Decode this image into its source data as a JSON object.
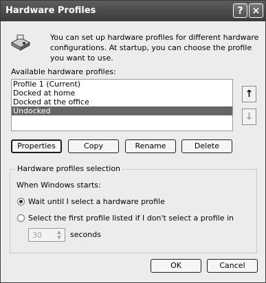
{
  "window": {
    "title": "Hardware Profiles",
    "help_icon": "?",
    "close_icon": "×"
  },
  "intro": {
    "icon": "hardware-profiles-icon",
    "text": "You can set up hardware profiles for different hardware configurations.  At startup, you can choose the profile you want to use."
  },
  "profiles": {
    "label": "Available hardware profiles:",
    "items": [
      {
        "label": "Profile 1 (Current)"
      },
      {
        "label": "Docked at home"
      },
      {
        "label": "Docked at the office"
      },
      {
        "label": "Undocked",
        "selected": true
      }
    ],
    "move_up_icon": "↑",
    "move_down_icon": "↓"
  },
  "buttons": {
    "properties": "Properties",
    "copy": "Copy",
    "rename": "Rename",
    "delete": "Delete"
  },
  "selection": {
    "group_title": "Hardware profiles selection",
    "prompt": "When Windows starts:",
    "option_wait": "Wait until I select a hardware profile",
    "option_first": "Select the first profile listed if I don't select a profile in",
    "seconds_value": "30",
    "seconds_label": "seconds",
    "selected_option": "wait"
  },
  "footer": {
    "ok": "OK",
    "cancel": "Cancel"
  }
}
